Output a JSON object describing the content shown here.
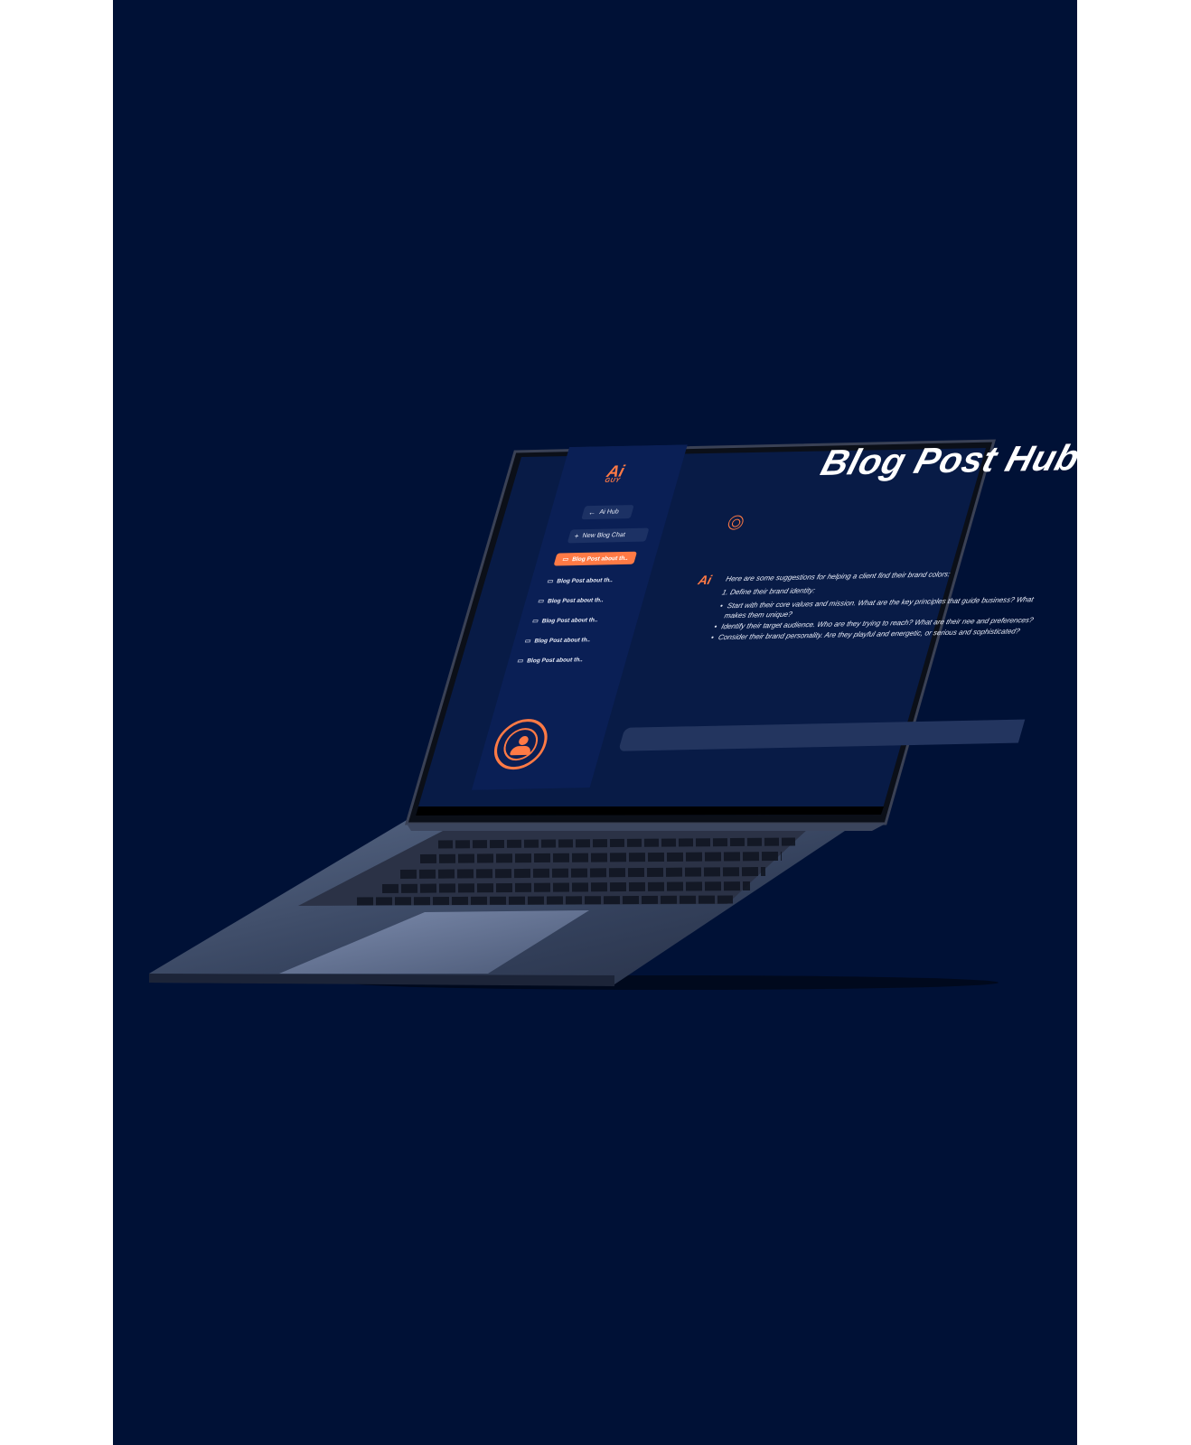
{
  "app": {
    "logo_main": "Ai",
    "logo_sub": "GUY",
    "page_title": "Blog Post Hub"
  },
  "sidebar": {
    "back_label": "Ai Hub",
    "new_chat_label": "New Blog Chat",
    "chats": [
      {
        "label": "Blog Post about th..",
        "active": true
      },
      {
        "label": "Blog Post about th.."
      },
      {
        "label": "Blog Post about th.."
      },
      {
        "label": "Blog Post about th.."
      },
      {
        "label": "Blog Post about th.."
      },
      {
        "label": "Blog Post about th.."
      }
    ]
  },
  "conversation": {
    "ai_badge": "Ai",
    "intro": "Here are some suggestions for helping a client find their brand colors:",
    "step": "1. Define their brand identity:",
    "bullets": [
      "Start with their core values and mission. What are the key principles that guide business? What makes them unique?",
      "Identify their target audience. Who are they trying to reach? What are their nee and preferences?",
      "Consider their brand personality. Are they playful and energetic, or serious and sophisticated?"
    ]
  },
  "colors": {
    "background": "#001136",
    "accent": "#ff7a45",
    "sidebar": "#0a1f55",
    "input": "#23355f"
  },
  "icons": [
    "arrow-left-icon",
    "plus-icon",
    "chat-icon",
    "user-avatar-icon"
  ]
}
